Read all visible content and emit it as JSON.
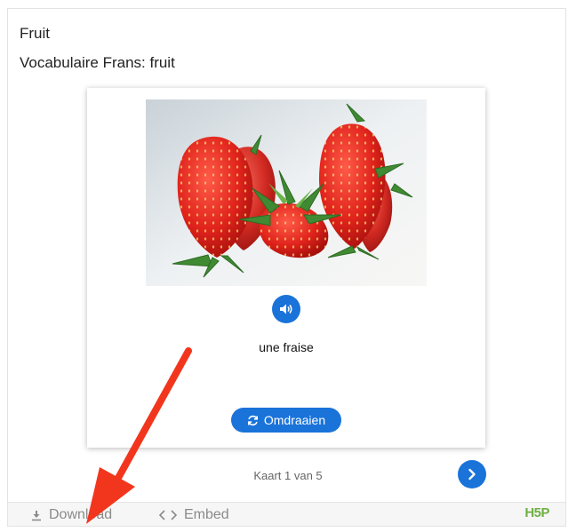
{
  "header": {
    "title": "Fruit",
    "subtitle": "Vocabulaire Frans: fruit"
  },
  "card": {
    "image_subject": "strawberries",
    "audio_icon": "speaker-icon",
    "text": "une fraise",
    "turn_label": "Omdraaien",
    "turn_icon": "refresh-icon"
  },
  "navigation": {
    "progress": "Kaart 1 van 5",
    "next_icon": "chevron-right-icon"
  },
  "footer": {
    "download_label": "Download",
    "embed_label": "Embed",
    "logo": "H5P"
  },
  "colors": {
    "accent": "#1a73d9",
    "annotation_arrow": "#f2361d",
    "logo": "#6fb043"
  }
}
